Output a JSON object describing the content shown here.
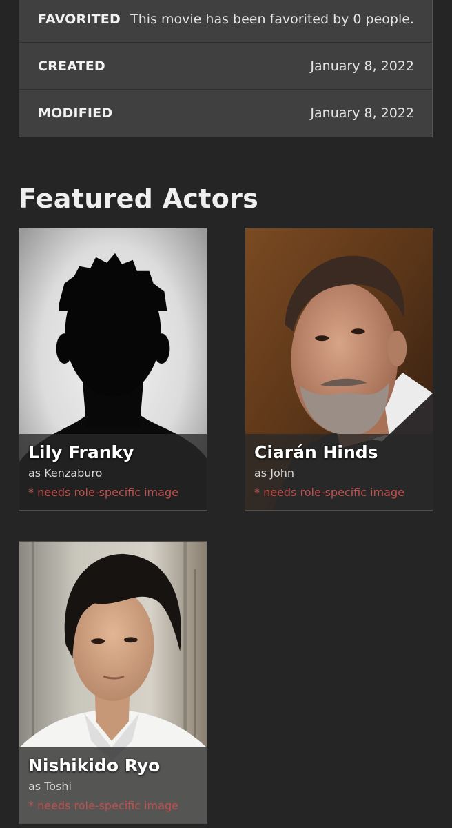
{
  "movie_details": {
    "rows": [
      {
        "label": "FAVORITED",
        "value": "This movie has been favorited by 0 people."
      },
      {
        "label": "CREATED",
        "value": "January 8, 2022"
      },
      {
        "label": "MODIFIED",
        "value": "January 8, 2022"
      }
    ]
  },
  "featured_actors": {
    "title": "Featured Actors",
    "actors": [
      {
        "name": "Lily Franky",
        "role": "as Kenzaburo",
        "note": "* needs role-specific image",
        "photo": "silhouette"
      },
      {
        "name": "Ciarán Hinds",
        "role": "as John",
        "note": "* needs role-specific image",
        "photo": "bearded-man-portrait"
      },
      {
        "name": "Nishikido Ryo",
        "role": "as Toshi",
        "note": "* needs role-specific image",
        "photo": "young-man-portrait"
      }
    ]
  },
  "colors": {
    "background": "#252525",
    "table_background": "#404040",
    "note_red": "#c0504d"
  }
}
